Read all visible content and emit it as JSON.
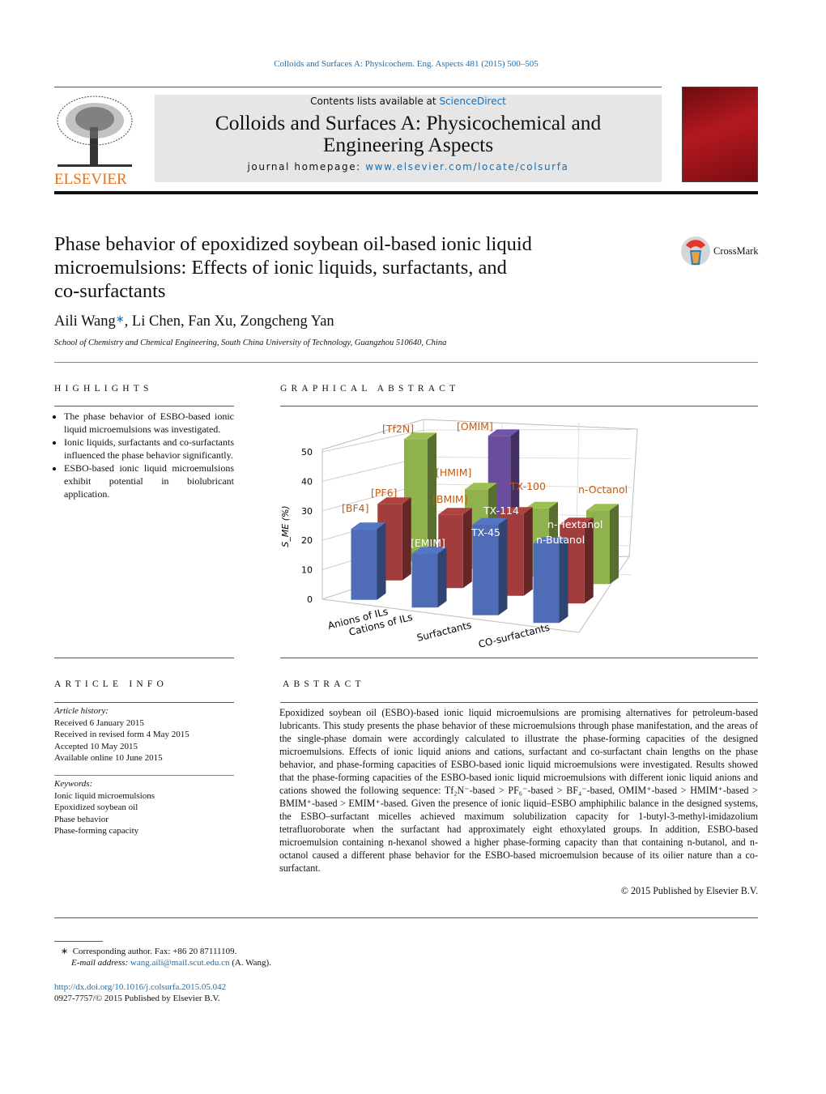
{
  "journal_ref": "Colloids and Surfaces A: Physicochem. Eng. Aspects 481 (2015) 500–505",
  "header": {
    "contents_prefix": "Contents lists available at ",
    "contents_link": "ScienceDirect",
    "journal_title_line1": "Colloids and Surfaces A: Physicochemical and",
    "journal_title_line2": "Engineering Aspects",
    "homepage_prefix": "journal homepage: ",
    "homepage_link": "www.elsevier.com/locate/colsurfa",
    "publisher_logo": "ELSEVIER",
    "brand_color": "#e9711c"
  },
  "crossmark": "CrossMark",
  "article": {
    "title_lines": [
      "Phase behavior of epoxidized soybean oil-based ionic liquid",
      "microemulsions: Effects of ionic liquids, surfactants, and",
      "co-surfactants"
    ],
    "author_first": "Aili Wang",
    "author_mark": "∗",
    "authors_rest": ", Li Chen, Fan Xu, Zongcheng Yan",
    "affiliation": "School of Chemistry and Chemical Engineering, South China University of Technology, Guangzhou 510640, China"
  },
  "highlights": {
    "heading": "HIGHLIGHTS",
    "items": [
      "The phase behavior of ESBO-based ionic liquid microemulsions was investigated.",
      "Ionic liquids, surfactants and co-surfactants influenced the phase behavior significantly.",
      "ESBO-based ionic liquid microemul­sions exhibit potential in biolubricant application."
    ]
  },
  "graphical_abstract": {
    "heading": "GRAPHICAL ABSTRACT"
  },
  "chart_data": {
    "type": "bar",
    "style": "3d-grouped",
    "ylabel": "S_ME (%)",
    "ylim": [
      0,
      50
    ],
    "yticks": [
      "0",
      "10",
      "20",
      "30",
      "40",
      "50"
    ],
    "grid": true,
    "categories": [
      "Anions of ILs",
      "Cations of ILs",
      "Surfactants",
      "CO-surfactants"
    ],
    "groups": [
      {
        "category": "Anions of ILs",
        "bars": [
          {
            "label": "[BF4]",
            "value": 25,
            "color": "#4f6cb6"
          },
          {
            "label": "[PF6]",
            "value": 27,
            "color": "#a33d3d"
          },
          {
            "label": "[Tf2N]",
            "value": 43,
            "color": "#8fb24c"
          }
        ]
      },
      {
        "category": "Cations of ILs",
        "bars": [
          {
            "label": "[EMIM]",
            "value": 19,
            "color": "#4f6cb6"
          },
          {
            "label": "[BMIM]",
            "value": 26,
            "color": "#a33d3d"
          },
          {
            "label": "[HMIM]",
            "value": 28,
            "color": "#8fb24c"
          },
          {
            "label": "[OMIM]",
            "value": 40,
            "color": "#6b4d9e"
          }
        ]
      },
      {
        "category": "Surfactants",
        "bars": [
          {
            "label": "TX-45",
            "value": 32,
            "color": "#4f6cb6"
          },
          {
            "label": "TX-114",
            "value": 29,
            "color": "#a33d3d"
          },
          {
            "label": "TX-100",
            "value": 24,
            "color": "#8fb24c"
          }
        ]
      },
      {
        "category": "CO-surfactants",
        "bars": [
          {
            "label": "n-Butanol",
            "value": 28,
            "color": "#4f6cb6"
          },
          {
            "label": "n-Hextanol",
            "value": 28,
            "color": "#a33d3d"
          },
          {
            "label": "n-Octanol",
            "value": 26,
            "color": "#8fb24c"
          }
        ]
      }
    ]
  },
  "article_info": {
    "heading": "ARTICLE INFO",
    "history_label": "Article history:",
    "history": [
      "Received 6 January 2015",
      "Received in revised form 4 May 2015",
      "Accepted 10 May 2015",
      "Available online 10 June 2015"
    ],
    "keywords_label": "Keywords:",
    "keywords": [
      "Ionic liquid microemulsions",
      "Epoxidized soybean oil",
      "Phase behavior",
      "Phase-forming capacity"
    ]
  },
  "abstract": {
    "heading": "ABSTRACT",
    "text": "Epoxidized soybean oil (ESBO)-based ionic liquid microemulsions are promising alternatives for petroleum-based lubricants. This study presents the phase behavior of these microemulsions through phase manifestation, and the areas of the single-phase domain were accordingly calculated to illustrate the phase-forming capacities of the designed microemulsions. Effects of ionic liquid anions and cations, surfactant and co-surfactant chain lengths on the phase behavior, and phase-forming capacities of ESBO-based ionic liquid microemulsions were investigated. Results showed that the phase-forming capacities of the ESBO-based ionic liquid microemulsions with different ionic liquid anions and cations showed the following sequence: Tf₂N⁻-based > PF₆⁻-based > BF₄⁻-based, OMIM⁺-based > HMIM⁺-based > BMIM⁺-based > EMIM⁺-based. Given the presence of ionic liquid–ESBO amphiphilic balance in the designed systems, the ESBO–surfactant micelles achieved maximum solubilization capacity for 1-butyl-3-methyl-imidazolium tetrafluoroborate when the surfactant had approximately eight ethoxylated groups. In addition, ESBO-based microemulsion containing n-hexanol showed a higher phase-forming capacity than that containing n-butanol, and n-octanol caused a different phase behavior for the ESBO-based microemulsion because of its oilier nature than a co-surfactant.",
    "copyright": "© 2015 Published by Elsevier B.V."
  },
  "footnote": {
    "mark": "∗",
    "corresponding": "Corresponding author. Fax: +86 20 87111109.",
    "email_label": "E-mail address: ",
    "email": "wang.aili@mail.scut.edu.cn",
    "email_suffix": " (A. Wang).",
    "doi": "http://dx.doi.org/10.1016/j.colsurfa.2015.05.042",
    "issn": "0927-7757/© 2015 Published by Elsevier B.V."
  }
}
